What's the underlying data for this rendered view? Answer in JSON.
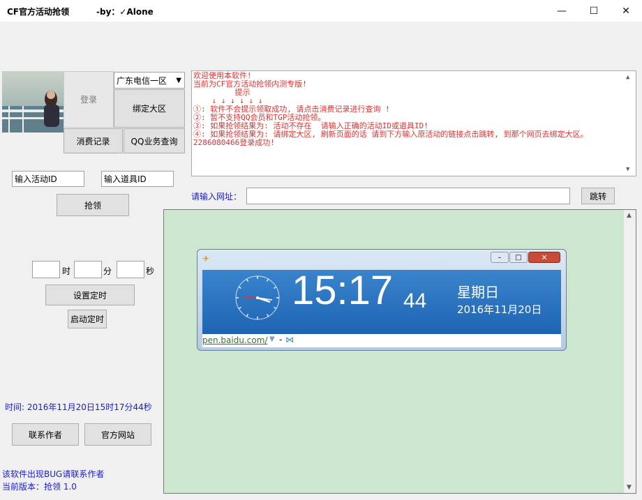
{
  "window": {
    "title": "CF官方活动抢领",
    "byline": "-by：✓Alone",
    "controls": {
      "minimize": "—",
      "maximize": "☐",
      "close": "✕"
    }
  },
  "account": {
    "server_select": "广东电信一区",
    "login_label": "登录",
    "bind_label": "绑定大区",
    "consume_label": "消费记录",
    "qq_query_label": "QQ业务查询"
  },
  "log": {
    "lines": [
      "欢迎使用本软件!",
      "当前为CF官方活动抢领内测专版!",
      "         提示",
      "    ↓ ↓ ↓ ↓ ↓ ↓",
      "①: 软件不会提示领取成功, 请点击消费记录进行查询 !",
      "②: 暂不支持QQ会员和TGP活动抢领。",
      "③: 如果抢领结果为: 活动不存在  请输入正确的活动ID或道具ID!",
      "④: 如果抢领结果为: 请绑定大区, 刷新页面的话 请到下方输入原活动的链接点击跳转, 到那个网页去绑定大区。",
      "2286080466登录成功!"
    ]
  },
  "activity": {
    "activity_id_value": "输入活动ID",
    "item_id_value": "输入道具ID",
    "grab_label": "抢领"
  },
  "url_bar": {
    "label": "请输入网址：",
    "value": "",
    "go_label": "跳转"
  },
  "timer": {
    "hour_label": "时",
    "minute_label": "分",
    "second_label": "秒",
    "hour_value": "",
    "minute_value": "",
    "second_value": "",
    "set_label": "设置定时",
    "start_label": "启动定时"
  },
  "status": {
    "time_text": "时间:  2016年11月20日15时17分44秒",
    "contact_label": "联系作者",
    "website_label": "官方网站",
    "bug_note": "该软件出现BUG请联系作者",
    "version": "当前版本：抢领 1.0"
  },
  "clock_widget": {
    "time": "15:17",
    "seconds": "44",
    "weekday": "星期日",
    "date": "2016年11月20日",
    "link": "pen.baidu.com/",
    "link_sep": "-"
  },
  "colors": {
    "accent_blue": "#1a1ad0",
    "log_red": "#e03030",
    "browser_bg": "#cde6d0",
    "clock_blue": "#2a74c2"
  }
}
